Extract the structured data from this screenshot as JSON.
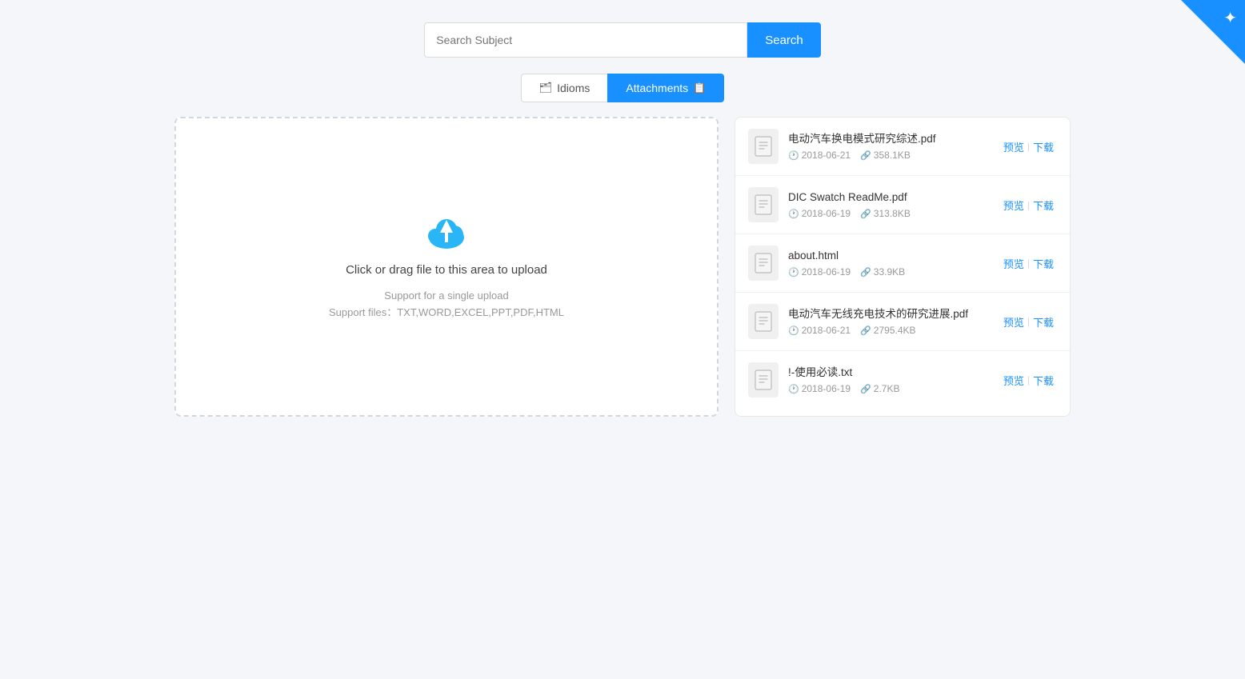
{
  "search": {
    "placeholder": "Search Subject",
    "button_label": "Search"
  },
  "tabs": [
    {
      "id": "idioms",
      "label": "Idioms",
      "active": false
    },
    {
      "id": "attachments",
      "label": "Attachments",
      "active": true
    }
  ],
  "upload": {
    "main_text": "Click or drag file to this area to upload",
    "sub_text_1": "Support for a single upload",
    "sub_text_2": "Support files：TXT,WORD,EXCEL,PPT,PDF,HTML"
  },
  "files": [
    {
      "name": "电动汽车换电模式研究综述.pdf",
      "date": "2018-06-21",
      "size": "358.1KB",
      "preview_label": "预览",
      "download_label": "下载"
    },
    {
      "name": "DIC Swatch ReadMe.pdf",
      "date": "2018-06-19",
      "size": "313.8KB",
      "preview_label": "预览",
      "download_label": "下载"
    },
    {
      "name": "about.html",
      "date": "2018-06-19",
      "size": "33.9KB",
      "preview_label": "预览",
      "download_label": "下载"
    },
    {
      "name": "电动汽车无线充电技术的研究进展.pdf",
      "date": "2018-06-21",
      "size": "2795.4KB",
      "preview_label": "预览",
      "download_label": "下载"
    },
    {
      "name": "!-使用必读.txt",
      "date": "2018-06-19",
      "size": "2.7KB",
      "preview_label": "预览",
      "download_label": "下载"
    }
  ],
  "corner_icon": "✦",
  "icons": {
    "clock": "🕐",
    "link": "🔗",
    "file": "📄",
    "folder": "🗂",
    "attachment": "📋"
  }
}
